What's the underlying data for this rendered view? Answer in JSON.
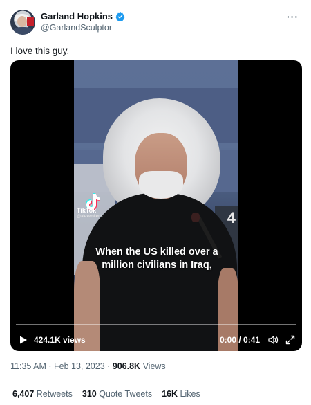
{
  "author": {
    "display_name": "Garland Hopkins",
    "handle": "@GarlandSculptor",
    "verified": true,
    "verified_color": "#1d9bf0"
  },
  "tweet": {
    "text": "I love this guy."
  },
  "video": {
    "watermark_brand": "TikTok",
    "watermark_user": "@alexwoltens",
    "caption_line1": "When the US killed over a",
    "caption_line2": "million civilians in Iraq,",
    "seat_number": "4",
    "views": "424.1K views",
    "time": "0:00 / 0:41",
    "progress_fraction": 0.0
  },
  "meta": {
    "timestamp": "11:35 AM · Feb 13, 2023 · ",
    "view_count": "906.8K",
    "views_label": " Views"
  },
  "stats": {
    "retweets_num": "6,407",
    "retweets_label": " Retweets",
    "quotes_num": "310",
    "quotes_label": " Quote Tweets",
    "likes_num": "16K",
    "likes_label": " Likes"
  },
  "icons": {
    "more": "more-icon",
    "verified": "verified-badge-icon",
    "play": "play-icon",
    "volume": "volume-icon",
    "fullscreen": "fullscreen-icon"
  }
}
